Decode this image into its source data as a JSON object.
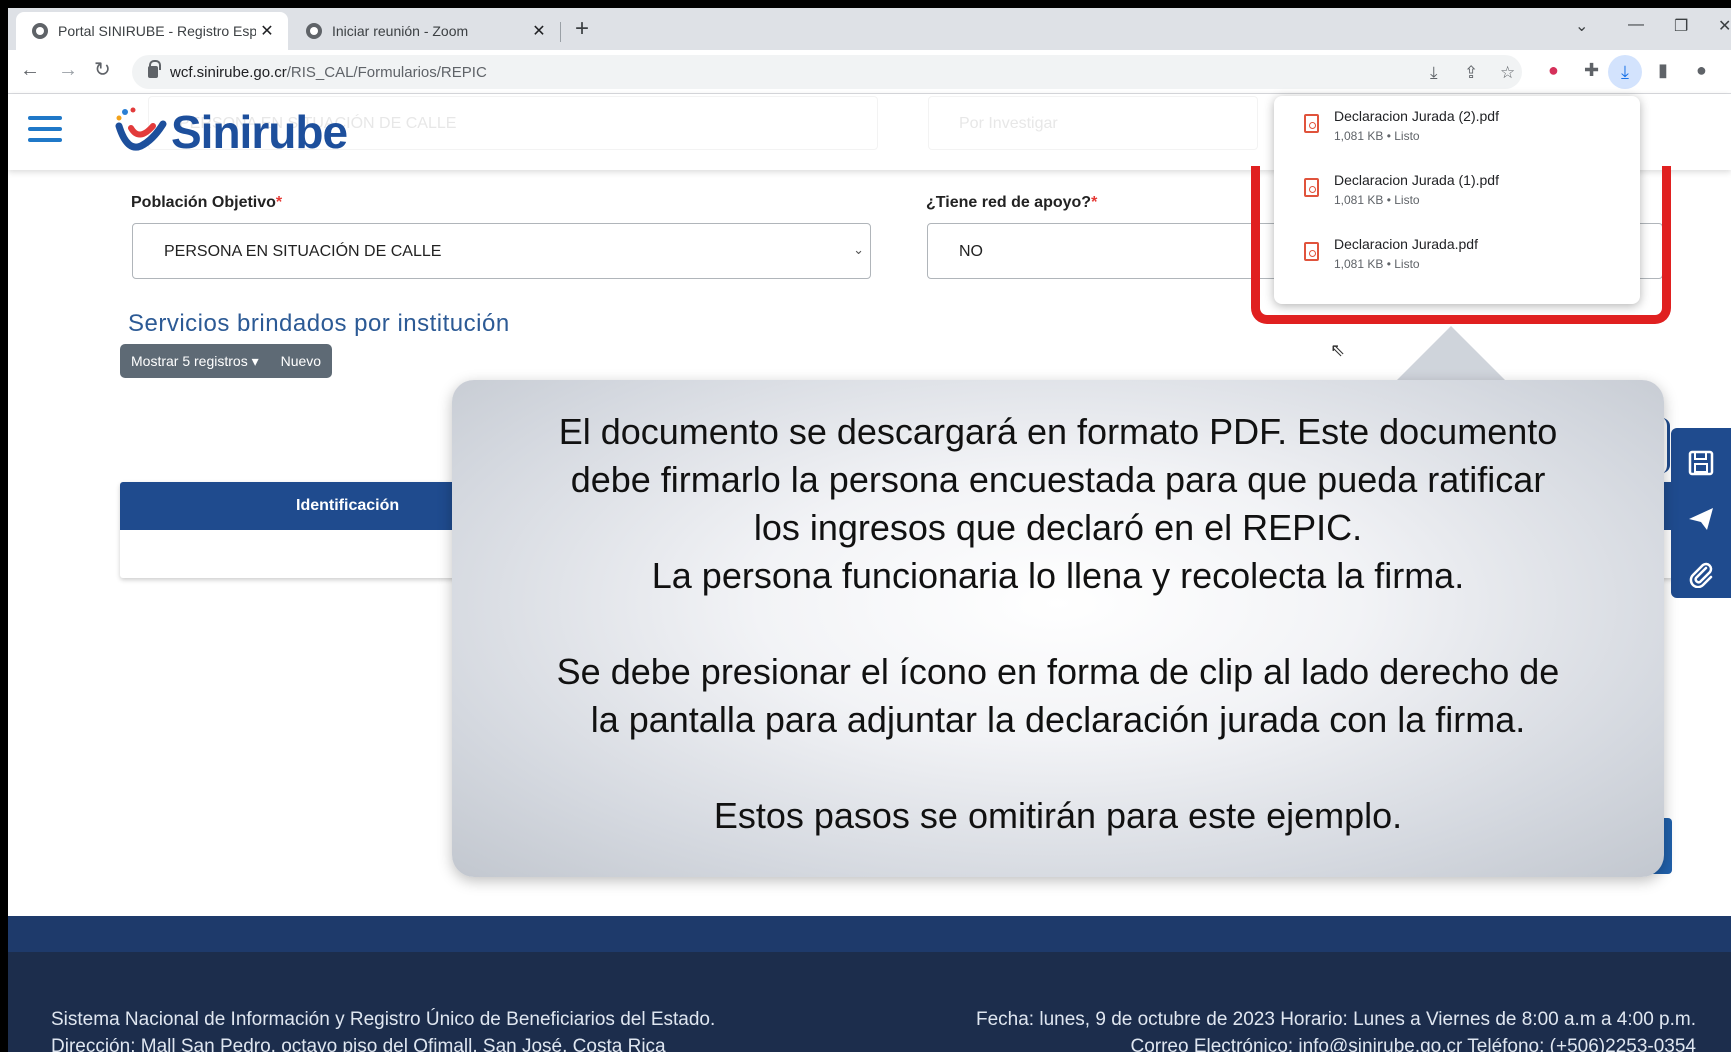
{
  "browser": {
    "tabs": [
      {
        "title": "Portal SINIRUBE - Registro Espec",
        "close": "✕"
      },
      {
        "title": "Iniciar reunión - Zoom",
        "close": "✕"
      }
    ],
    "new_tab": "+",
    "url_host": "wcf.sinirube.go.cr",
    "url_path": "/RIS_CAL/Formularios/REPIC"
  },
  "header": {
    "logo": "Sinirube",
    "ghost_left": "PERSONA EN SITUACIÓN DE CALLE",
    "ghost_right": "Por Investigar"
  },
  "form": {
    "poblacion_label": "Población Objetivo",
    "poblacion_value": "PERSONA EN SITUACIÓN DE CALLE",
    "red_label": "¿Tiene red de apoyo?",
    "red_value": "NO",
    "required": "*"
  },
  "section": {
    "title": "Servicios brindados por institución",
    "show_records": "Mostrar 5 registros",
    "new": "Nuevo",
    "col_identificacion": "Identificación"
  },
  "downloads": [
    {
      "name": "Declaracion Jurada (2).pdf",
      "meta": "1,081 KB • Listo"
    },
    {
      "name": "Declaracion Jurada (1).pdf",
      "meta": "1,081 KB • Listo"
    },
    {
      "name": "Declaracion Jurada.pdf",
      "meta": "1,081 KB • Listo"
    }
  ],
  "callout": {
    "lines": [
      "El documento se descargará en formato PDF. Este documento",
      "debe firmarlo la persona encuestada para que pueda ratificar",
      "los ingresos que declaró en el REPIC.",
      "La persona funcionaria lo llena y recolecta la firma.",
      "Se debe presionar el ícono en forma de clip al lado derecho de",
      "la pantalla para adjuntar la declaración jurada con la firma.",
      "Estos pasos se omitirán para este ejemplo."
    ]
  },
  "footer": {
    "line1_left": "Sistema Nacional de Información y Registro Único de Beneficiarios del Estado.",
    "line1_right": "Fecha: lunes, 9 de octubre de 2023   Horario: Lunes a Viernes de 8:00 a.m a 4:00 p.m.",
    "line2_left": "Dirección: Mall San Pedro, octavo piso del Ofimall, San José, Costa Rica",
    "line2_right": "Correo Electrónico: info@sinirube.go.cr Teléfono: (+506)2253-0354"
  },
  "colors": {
    "brand_blue": "#1f4b8e",
    "highlight_red": "#e02020",
    "footer": "#1c2d4c"
  }
}
